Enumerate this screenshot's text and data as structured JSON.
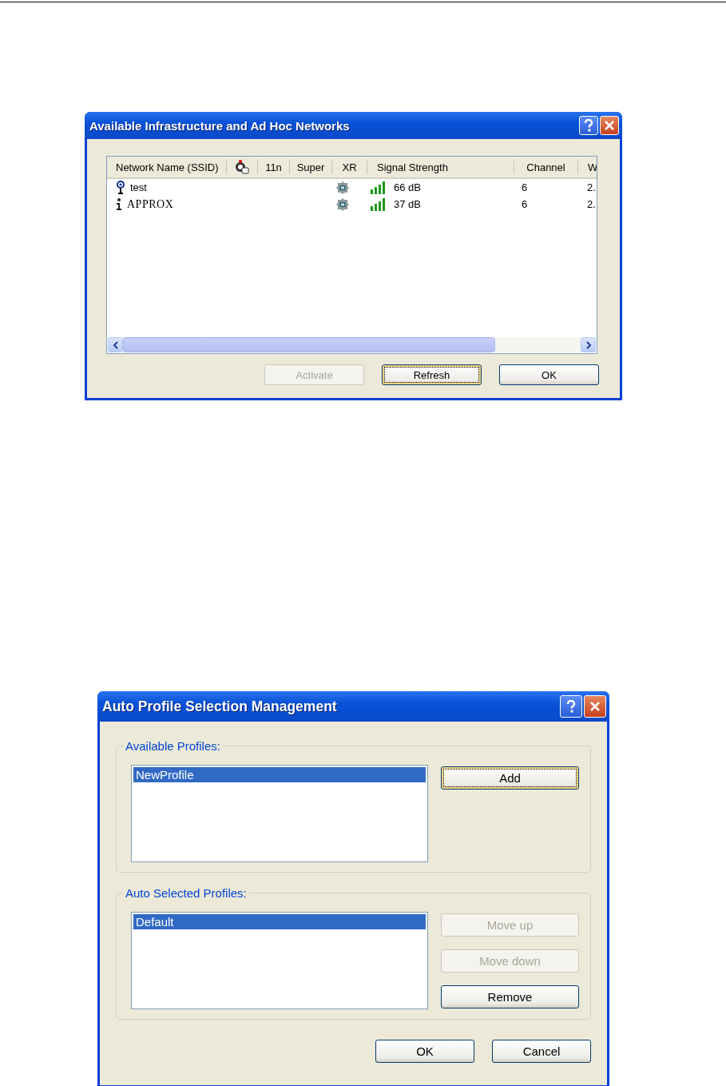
{
  "networks_dialog": {
    "title": "Available Infrastructure and Ad Hoc Networks",
    "columns": [
      {
        "kind": "text",
        "label": "Network Name (SSID)"
      },
      {
        "kind": "icon"
      },
      {
        "kind": "text",
        "label": "11n"
      },
      {
        "kind": "text",
        "label": "Super"
      },
      {
        "kind": "text",
        "label": "XR"
      },
      {
        "kind": "text",
        "label": "Signal Strength"
      },
      {
        "kind": "text",
        "label": "Channel"
      },
      {
        "kind": "text",
        "label": "W"
      }
    ],
    "rows": [
      {
        "kind": "infrastructure",
        "name": "test",
        "xr": true,
        "signal": "66 dB",
        "channel": "6",
        "column_8": "2."
      },
      {
        "kind": "adhoc",
        "name": "APPROX",
        "xr": true,
        "signal": "37 dB",
        "channel": "6",
        "column_8": "2."
      }
    ],
    "buttons": [
      {
        "label": "Activate",
        "disabled": true,
        "focused": false
      },
      {
        "label": "Refresh",
        "disabled": false,
        "focused": true
      },
      {
        "label": "OK",
        "disabled": false,
        "focused": false
      }
    ]
  },
  "profiles_dialog": {
    "title": "Auto Profile Selection Management",
    "groups": [
      {
        "legend": "Available Profiles:",
        "items": [
          {
            "label": "NewProfile",
            "selected": true
          }
        ],
        "buttons": [
          {
            "label": "Add",
            "disabled": false,
            "focused": true
          }
        ]
      },
      {
        "legend": "Auto Selected Profiles:",
        "items": [
          {
            "label": "Default",
            "selected": true
          }
        ],
        "buttons": [
          {
            "label": "Move up",
            "disabled": true,
            "focused": false
          },
          {
            "label": "Move down",
            "disabled": true,
            "focused": false
          },
          {
            "label": "Remove",
            "disabled": false,
            "focused": false
          }
        ]
      }
    ],
    "buttons": [
      {
        "label": "OK",
        "disabled": false,
        "focused": false
      },
      {
        "label": "Cancel",
        "disabled": false,
        "focused": false
      }
    ]
  }
}
